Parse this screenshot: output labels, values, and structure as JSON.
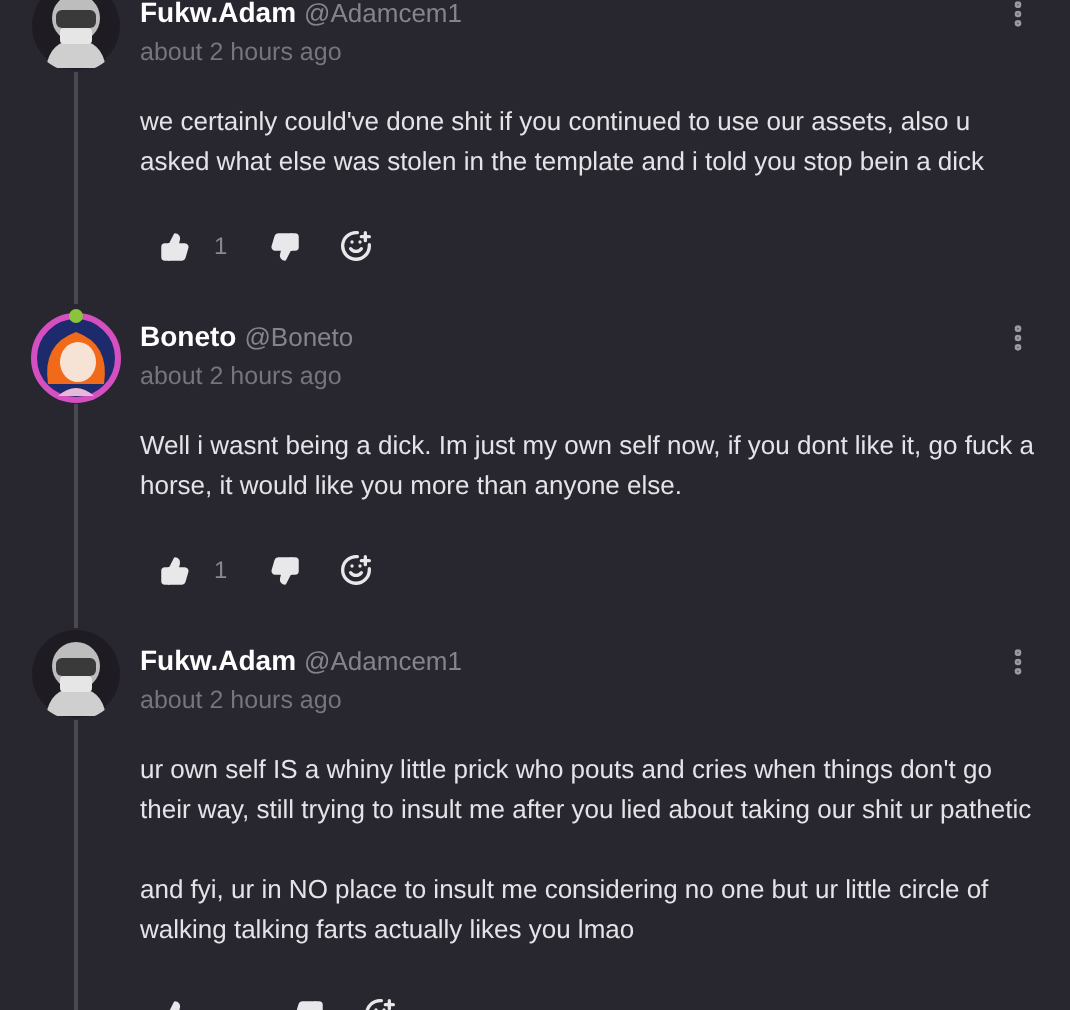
{
  "comments": [
    {
      "author": "Fukw.Adam",
      "handle": "@Adamcem1",
      "time": "about 2 hours ago",
      "kind": "hooded",
      "paragraphs": [
        "we certainly could've done shit if you continued to use our assets, also u asked what else was stolen in the template and i told you stop bein a dick"
      ],
      "likes": "1"
    },
    {
      "author": "Boneto",
      "handle": "@Boneto",
      "time": "about 2 hours ago",
      "kind": "redhead",
      "paragraphs": [
        "Well i wasnt being a dick. Im just my own self now, if you dont like it, go fuck a horse, it would like you more than anyone else."
      ],
      "likes": "1"
    },
    {
      "author": "Fukw.Adam",
      "handle": "@Adamcem1",
      "time": "about 2 hours ago",
      "kind": "hooded",
      "paragraphs": [
        "ur own self IS a whiny little prick who pouts and cries when things don't go their way, still trying to insult me after you lied about taking our shit ur pathetic",
        "and fyi, ur in NO place to insult me considering no one but ur little circle of walking talking farts actually likes you lmao"
      ]
    }
  ]
}
